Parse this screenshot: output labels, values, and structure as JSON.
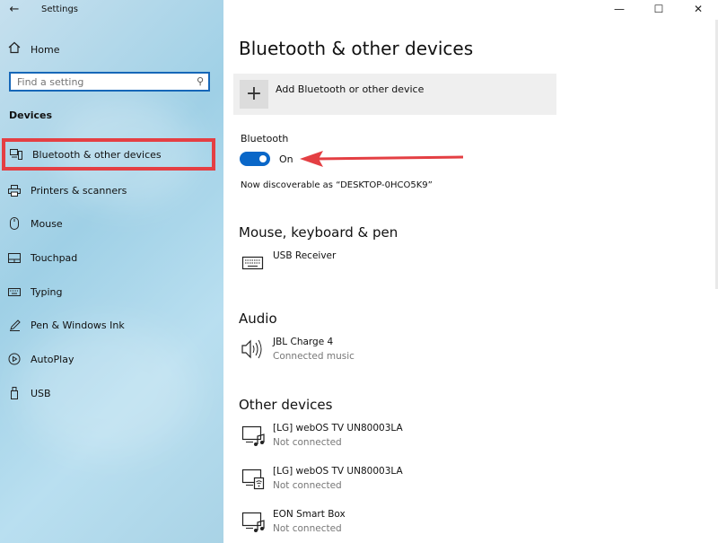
{
  "window": {
    "title": "Settings",
    "controls": [
      "—",
      "☐",
      "✕"
    ]
  },
  "sidebar": {
    "home_label": "Home",
    "search_placeholder": "Find a setting",
    "section_title": "Devices",
    "items": [
      {
        "label": "Bluetooth & other devices",
        "icon": "bluetooth-devices-icon",
        "active": true
      },
      {
        "label": "Printers & scanners",
        "icon": "printer-icon"
      },
      {
        "label": "Mouse",
        "icon": "mouse-icon"
      },
      {
        "label": "Touchpad",
        "icon": "touchpad-icon"
      },
      {
        "label": "Typing",
        "icon": "keyboard-icon"
      },
      {
        "label": "Pen & Windows Ink",
        "icon": "pen-icon"
      },
      {
        "label": "AutoPlay",
        "icon": "autoplay-icon"
      },
      {
        "label": "USB",
        "icon": "usb-icon"
      }
    ]
  },
  "main": {
    "title": "Bluetooth & other devices",
    "add_device_label": "Add Bluetooth or other device",
    "bluetooth_label": "Bluetooth",
    "bluetooth_state": "On",
    "discoverable_text": "Now discoverable as “DESKTOP-0HCO5K9”",
    "sections": {
      "mouse_keyboard": {
        "title": "Mouse, keyboard & pen",
        "devices": [
          {
            "name": "USB Receiver",
            "status": "",
            "icon": "keyboard-icon"
          }
        ]
      },
      "audio": {
        "title": "Audio",
        "devices": [
          {
            "name": "JBL Charge 4",
            "status": "Connected music",
            "icon": "speaker-icon"
          }
        ]
      },
      "other": {
        "title": "Other devices",
        "devices": [
          {
            "name": "[LG] webOS TV UN80003LA",
            "status": "Not connected",
            "icon": "media-device-icon"
          },
          {
            "name": "[LG] webOS TV UN80003LA",
            "status": "Not connected",
            "icon": "wireless-display-icon"
          },
          {
            "name": "EON Smart Box",
            "status": "Not connected",
            "icon": "media-device-icon"
          }
        ]
      }
    }
  },
  "colors": {
    "accent": "#0a67c8",
    "highlight": "#e43f43",
    "search_border": "#1667b8"
  }
}
